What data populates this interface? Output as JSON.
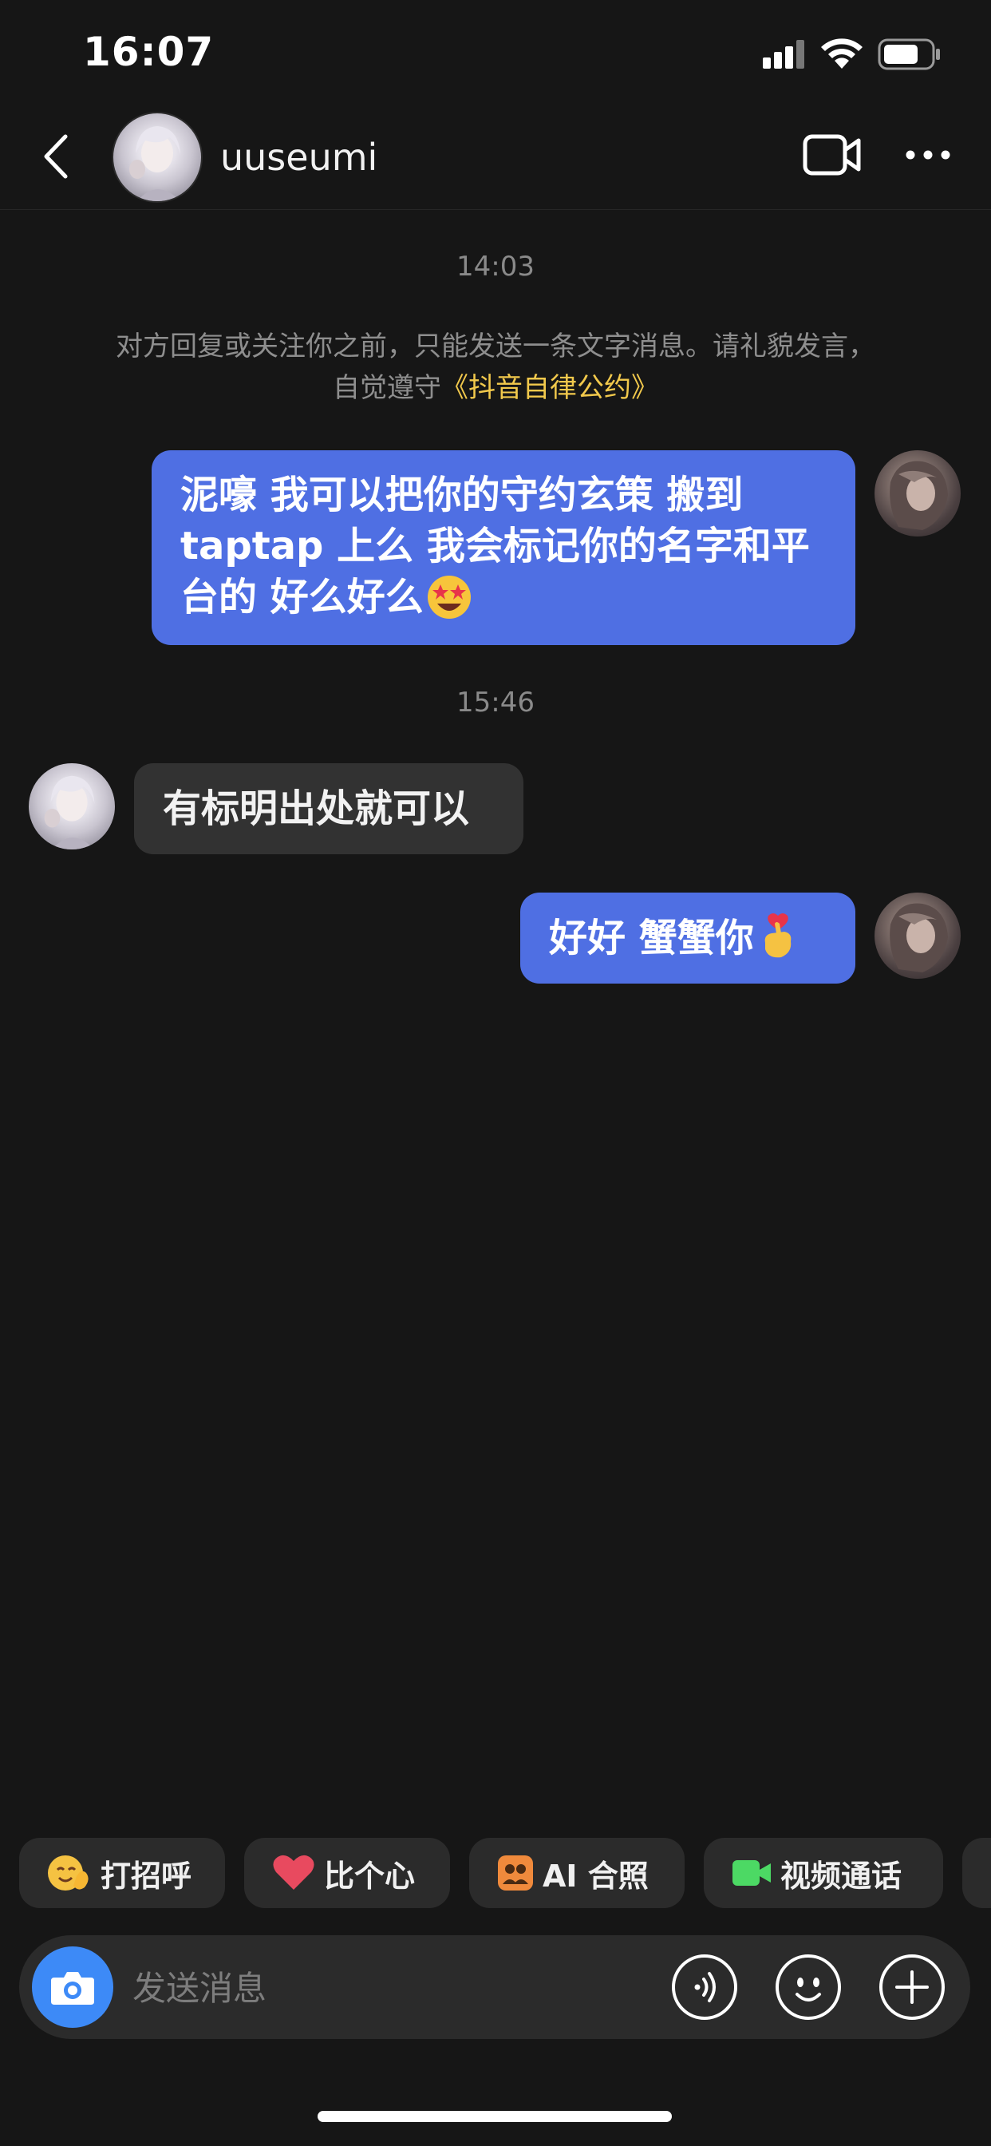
{
  "status_bar": {
    "time": "16:07"
  },
  "header": {
    "username": "uuseumi"
  },
  "chat": {
    "time_1": "14:03",
    "notice_text": "对方回复或关注你之前，只能发送一条文字消息。请礼貌发言，自觉遵守",
    "notice_link": "《抖音自律公约》",
    "msg_1_line_1": "泥嚎  我可以把你的守约玄策 搬到",
    "msg_1_line_2": "taptap 上么  我会标记你的名字和平",
    "msg_1_line_3": "台的 好么好么",
    "time_2": "15:46",
    "msg_2": "有标明出处就可以",
    "msg_3": "好好  蟹蟹你"
  },
  "quick_actions": [
    {
      "label": "打招呼",
      "icon": "wave-emoji-icon"
    },
    {
      "label": "比个心",
      "icon": "heart-icon"
    },
    {
      "label": "AI 合照",
      "icon": "ai-photo-icon"
    },
    {
      "label": "视频通话",
      "icon": "video-camera-icon"
    }
  ],
  "input": {
    "placeholder": "发送消息"
  },
  "colors": {
    "background": "#161616",
    "sent_bubble": "#4f6fe3",
    "received_bubble": "#323232",
    "link": "#f2c94c",
    "camera_button": "#3d8af7"
  }
}
